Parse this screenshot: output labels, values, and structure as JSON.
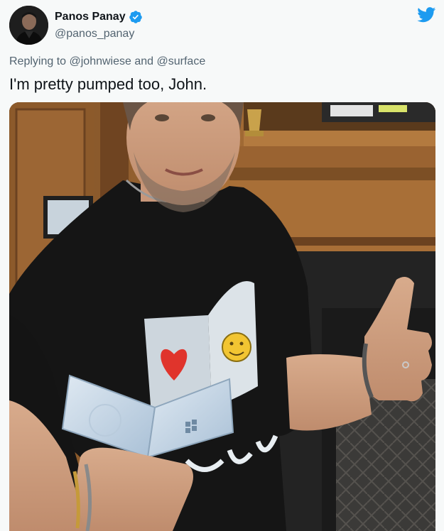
{
  "tweet": {
    "author": {
      "display_name": "Panos Panay",
      "handle": "@panos_panay",
      "verified": true,
      "avatar_icon": "profile-photo"
    },
    "reply": {
      "prefix": "Replying to",
      "mention_1": "@johnwiese",
      "connector": "and",
      "mention_2": "@surface"
    },
    "text": "I'm pretty pumped too, John.",
    "media": {
      "type": "photo",
      "icon": "photo-man-holding-surface-duo"
    },
    "brand_icon": "twitter-bird-icon"
  },
  "colors": {
    "background": "#f7f9f9",
    "primary_text": "#0f1419",
    "secondary_text": "#536471",
    "twitter_blue": "#1d9bf0"
  }
}
